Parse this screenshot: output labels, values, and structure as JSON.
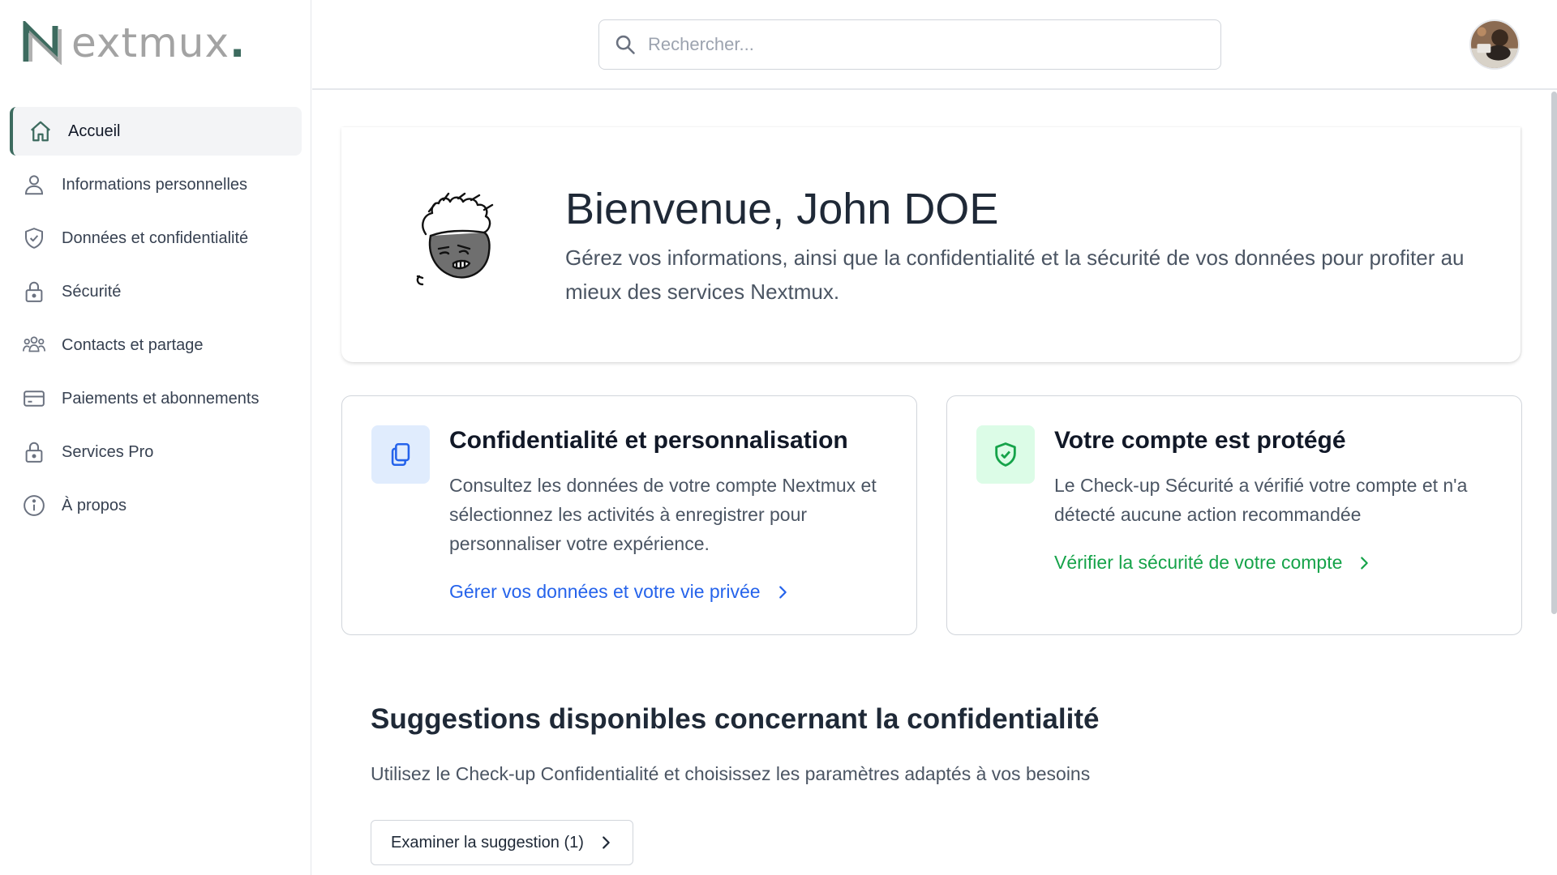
{
  "brand": {
    "name": "extmux",
    "dot": ".",
    "accent": "#3d6b5f"
  },
  "sidebar": {
    "items": [
      {
        "label": "Accueil",
        "icon": "home-icon",
        "active": true
      },
      {
        "label": "Informations personnelles",
        "icon": "user-icon"
      },
      {
        "label": "Données et confidentialité",
        "icon": "shield-check-icon"
      },
      {
        "label": "Sécurité",
        "icon": "lock-icon"
      },
      {
        "label": "Contacts et partage",
        "icon": "users-icon"
      },
      {
        "label": "Paiements et abonnements",
        "icon": "credit-card-icon"
      },
      {
        "label": "Services Pro",
        "icon": "lock-icon"
      },
      {
        "label": "À propos",
        "icon": "info-icon"
      }
    ]
  },
  "header": {
    "search": {
      "placeholder": "Rechercher..."
    }
  },
  "welcome": {
    "title": "Bienvenue, John DOE",
    "subtitle": "Gérez vos informations, ainsi que la confidentialité et la sécurité de vos données pour profiter au mieux des services Nextmux."
  },
  "cards": {
    "privacy": {
      "title": "Confidentialité et personnalisation",
      "description": "Consultez les données de votre compte Nextmux et sélectionnez les activités à enregistrer pour personnaliser votre expérience.",
      "link": "Gérer vos données et votre vie privée",
      "icon": "copy-icon",
      "color": "#2563eb",
      "icon_bg": "#e0ecfd"
    },
    "security": {
      "title": "Votre compte est protégé",
      "description": "Le Check-up Sécurité a vérifié votre compte et n'a détecté aucune action recommandée",
      "link": "Vérifier la sécurité de votre compte",
      "icon": "shield-check-icon",
      "color": "#16a34a",
      "icon_bg": "#dcfce7"
    }
  },
  "suggestions": {
    "title": "Suggestions disponibles concernant la confidentialité",
    "subtitle": "Utilisez le Check-up Confidentialité et choisissez les paramètres adaptés à vos besoins",
    "button": "Examiner la suggestion (1)"
  }
}
